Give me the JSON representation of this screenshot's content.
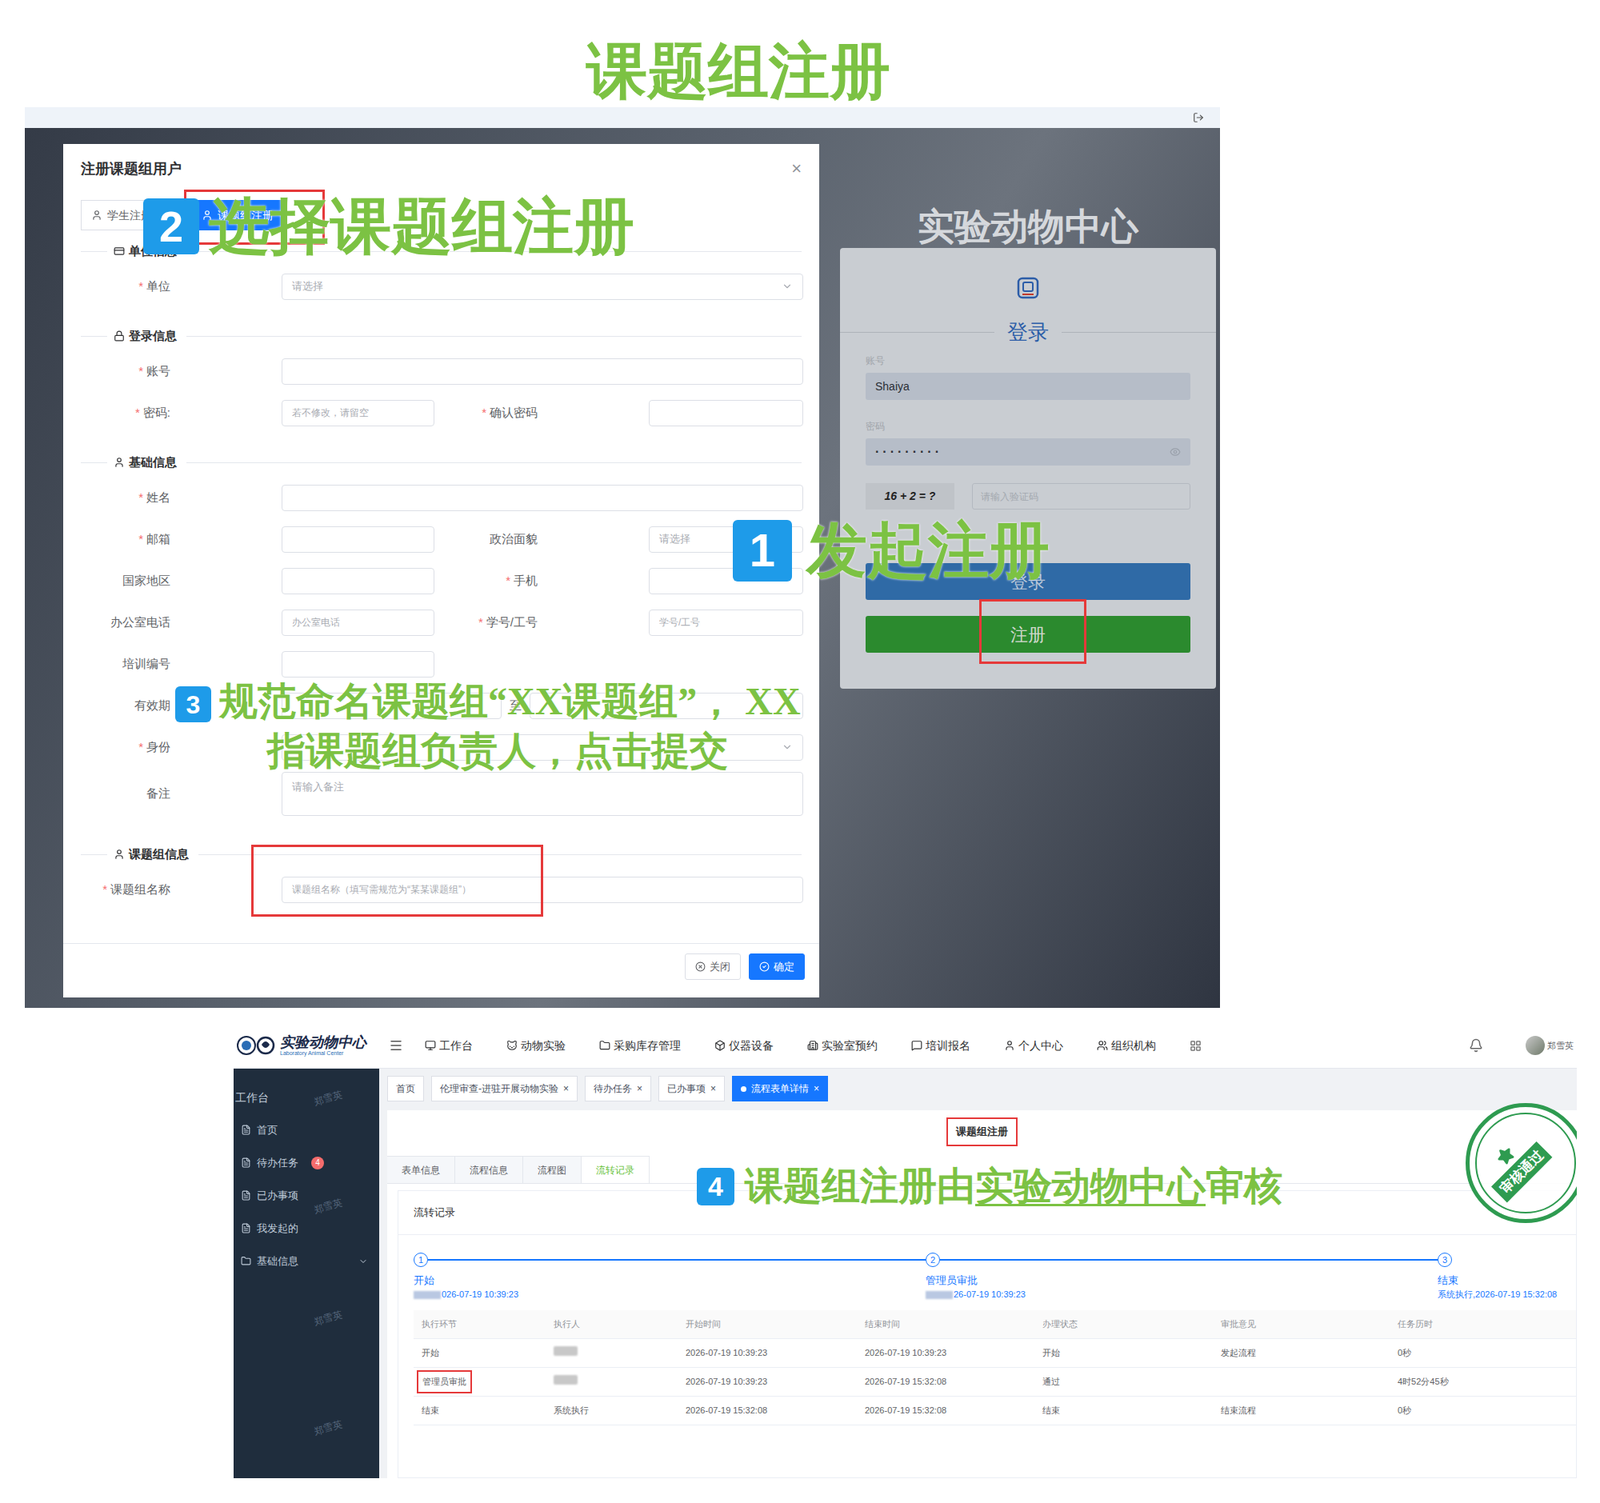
{
  "title": "课题组注册",
  "annotations": [
    {
      "number": "2",
      "lines": [
        [
          {
            "text": "选择课题组注册",
            "underlined": false
          }
        ]
      ]
    },
    {
      "number": "1",
      "lines": [
        [
          {
            "text": "发起注册",
            "underlined": false
          }
        ]
      ]
    },
    {
      "number": "3",
      "lines": [
        [
          {
            "text": "规范命名课题组“XX课题组”， XX",
            "underlined": false
          }
        ],
        [
          {
            "text": "指课题组负责人，点击提交",
            "underlined": false
          }
        ]
      ]
    },
    {
      "number": "4",
      "lines": [
        [
          {
            "text": "课题组注册由",
            "underlined": false
          },
          {
            "text": "实验动物中心",
            "underlined": true
          },
          {
            "text": "审核",
            "underlined": false
          }
        ]
      ]
    }
  ],
  "register_screenshot": {
    "dialog": {
      "title": "注册课题组用户",
      "close": "×",
      "required_mark": "*",
      "tabs": [
        {
          "label": "学生注册",
          "selected": false,
          "highlighted": false
        },
        {
          "label": "课题组注册",
          "selected": true,
          "highlighted": true
        }
      ],
      "sections": [
        {
          "title": "单位信息",
          "rows": [
            [
              {
                "label": "单位",
                "required": true,
                "kind": "select",
                "placeholder": "请选择",
                "highlighted": false
              }
            ]
          ]
        },
        {
          "title": "登录信息",
          "rows": [
            [
              {
                "label": "账号",
                "required": true,
                "kind": "input",
                "placeholder": "",
                "highlighted": false
              }
            ],
            [
              {
                "label": "密码:",
                "required": true,
                "kind": "input",
                "placeholder": "若不修改，请留空",
                "highlighted": false
              },
              {
                "label": "确认密码",
                "required": true,
                "kind": "input",
                "placeholder": "",
                "highlighted": false
              }
            ]
          ]
        },
        {
          "title": "基础信息",
          "rows": [
            [
              {
                "label": "姓名",
                "required": true,
                "kind": "input",
                "placeholder": "",
                "highlighted": false
              }
            ],
            [
              {
                "label": "邮箱",
                "required": true,
                "kind": "input",
                "placeholder": "",
                "highlighted": false
              },
              {
                "label": "政治面貌",
                "required": false,
                "kind": "select",
                "placeholder": "请选择",
                "highlighted": false
              }
            ],
            [
              {
                "label": "国家地区",
                "required": false,
                "kind": "input",
                "placeholder": "",
                "highlighted": false
              },
              {
                "label": "手机",
                "required": true,
                "kind": "input",
                "placeholder": "",
                "highlighted": false
              }
            ],
            [
              {
                "label": "办公室电话",
                "required": false,
                "kind": "input",
                "placeholder": "办公室电话",
                "highlighted": false
              },
              {
                "label": "学号/工号",
                "required": true,
                "kind": "input",
                "placeholder": "学号/工号",
                "highlighted": false
              }
            ],
            [
              {
                "label": "培训编号",
                "required": false,
                "kind": "short",
                "placeholder": "",
                "highlighted": false
              }
            ],
            [
              {
                "label": "有效期",
                "required": false,
                "kind": "date-range",
                "separator": "至",
                "placeholder": "",
                "highlighted": false
              }
            ],
            [
              {
                "label": "身份",
                "required": true,
                "kind": "select",
                "placeholder": "",
                "highlighted": false
              }
            ],
            [
              {
                "label": "备注",
                "required": false,
                "kind": "textarea",
                "placeholder": "请输入备注",
                "highlighted": false
              }
            ]
          ]
        },
        {
          "title": "课题组信息",
          "rows": [
            [
              {
                "label": "课题组名称",
                "required": true,
                "kind": "input",
                "placeholder": "课题组名称（填写需规范为“某某课题组”）",
                "highlighted": true
              }
            ]
          ]
        }
      ],
      "buttons": [
        {
          "label": "关闭",
          "kind": "secondary"
        },
        {
          "label": "确定",
          "kind": "primary"
        }
      ]
    },
    "login": {
      "app_title": "实验动物中心",
      "heading": "登录",
      "fields": [
        {
          "label": "账号",
          "value": "Shaiya",
          "kind": "text"
        },
        {
          "label": "密码",
          "value": "·········",
          "kind": "password"
        }
      ],
      "captcha": {
        "question": "16 + 2 = ?",
        "placeholder": "请输入验证码"
      },
      "buttons": [
        {
          "label": "登录",
          "kind": "login",
          "highlighted": false
        },
        {
          "label": "注册",
          "kind": "register",
          "highlighted": true
        }
      ]
    }
  },
  "review_screenshot": {
    "nav": {
      "logo_text": "实验动物中心",
      "logo_subtext": "Laboratory Animal Center",
      "menu": [
        "工作台",
        "动物实验",
        "采购库存管理",
        "仪器设备",
        "实验室预约",
        "培训报名",
        "个人中心",
        "组织机构"
      ],
      "user": "郑雪英"
    },
    "sidebar": {
      "header": "工作台",
      "watermark": "郑雪英",
      "items": [
        {
          "label": "首页",
          "expandable": false
        },
        {
          "label": "待办任务",
          "expandable": false,
          "badge": "4"
        },
        {
          "label": "已办事项",
          "expandable": false
        },
        {
          "label": "我发起的",
          "expandable": false
        },
        {
          "label": "基础信息",
          "expandable": true
        }
      ]
    },
    "close_glyph": "×",
    "tabs": [
      {
        "label": "首页",
        "closable": false,
        "selected": false
      },
      {
        "label": "伦理审查-进驻开展动物实验",
        "closable": true,
        "selected": false
      },
      {
        "label": "待办任务",
        "closable": true,
        "selected": false
      },
      {
        "label": "已办事项",
        "closable": true,
        "selected": false
      },
      {
        "label": "流程表单详情",
        "closable": true,
        "selected": true
      }
    ],
    "page_title": {
      "text": "课题组注册",
      "highlighted": true
    },
    "detail_tabs": [
      {
        "label": "表单信息",
        "selected": false
      },
      {
        "label": "流程信息",
        "selected": false
      },
      {
        "label": "流程图",
        "selected": false
      },
      {
        "label": "流转记录",
        "selected": true
      }
    ],
    "record": {
      "title": "流转记录",
      "steps": [
        {
          "number": "1",
          "name": "开始",
          "meta": "026-07-19 10:39:23",
          "redacted_prefix": true
        },
        {
          "number": "2",
          "name": "管理员审批",
          "meta": "26-07-19 10:39:23",
          "redacted_prefix": true
        },
        {
          "number": "3",
          "name": "结束",
          "meta": "系统执行,2026-07-19 15:32:08",
          "redacted_prefix": false
        }
      ],
      "table": {
        "columns": [
          "执行环节",
          "执行人",
          "开始时间",
          "结束时间",
          "办理状态",
          "审批意见",
          "任务历时"
        ],
        "rows": [
          {
            "cells": [
              "开始",
              "",
              "2026-07-19 10:39:23",
              "2026-07-19 10:39:23",
              "开始",
              "发起流程",
              "0秒"
            ],
            "executor_redacted": true,
            "highlighted": false
          },
          {
            "cells": [
              "管理员审批",
              "",
              "2026-07-19 10:39:23",
              "2026-07-19 15:32:08",
              "通过",
              "",
              "4时52分45秒"
            ],
            "executor_redacted": true,
            "highlighted": true
          },
          {
            "cells": [
              "结束",
              "系统执行",
              "2026-07-19 15:32:08",
              "2026-07-19 15:32:08",
              "结束",
              "结束流程",
              "0秒"
            ],
            "executor_redacted": false,
            "highlighted": false
          }
        ]
      }
    },
    "stamp": "审核通过"
  }
}
